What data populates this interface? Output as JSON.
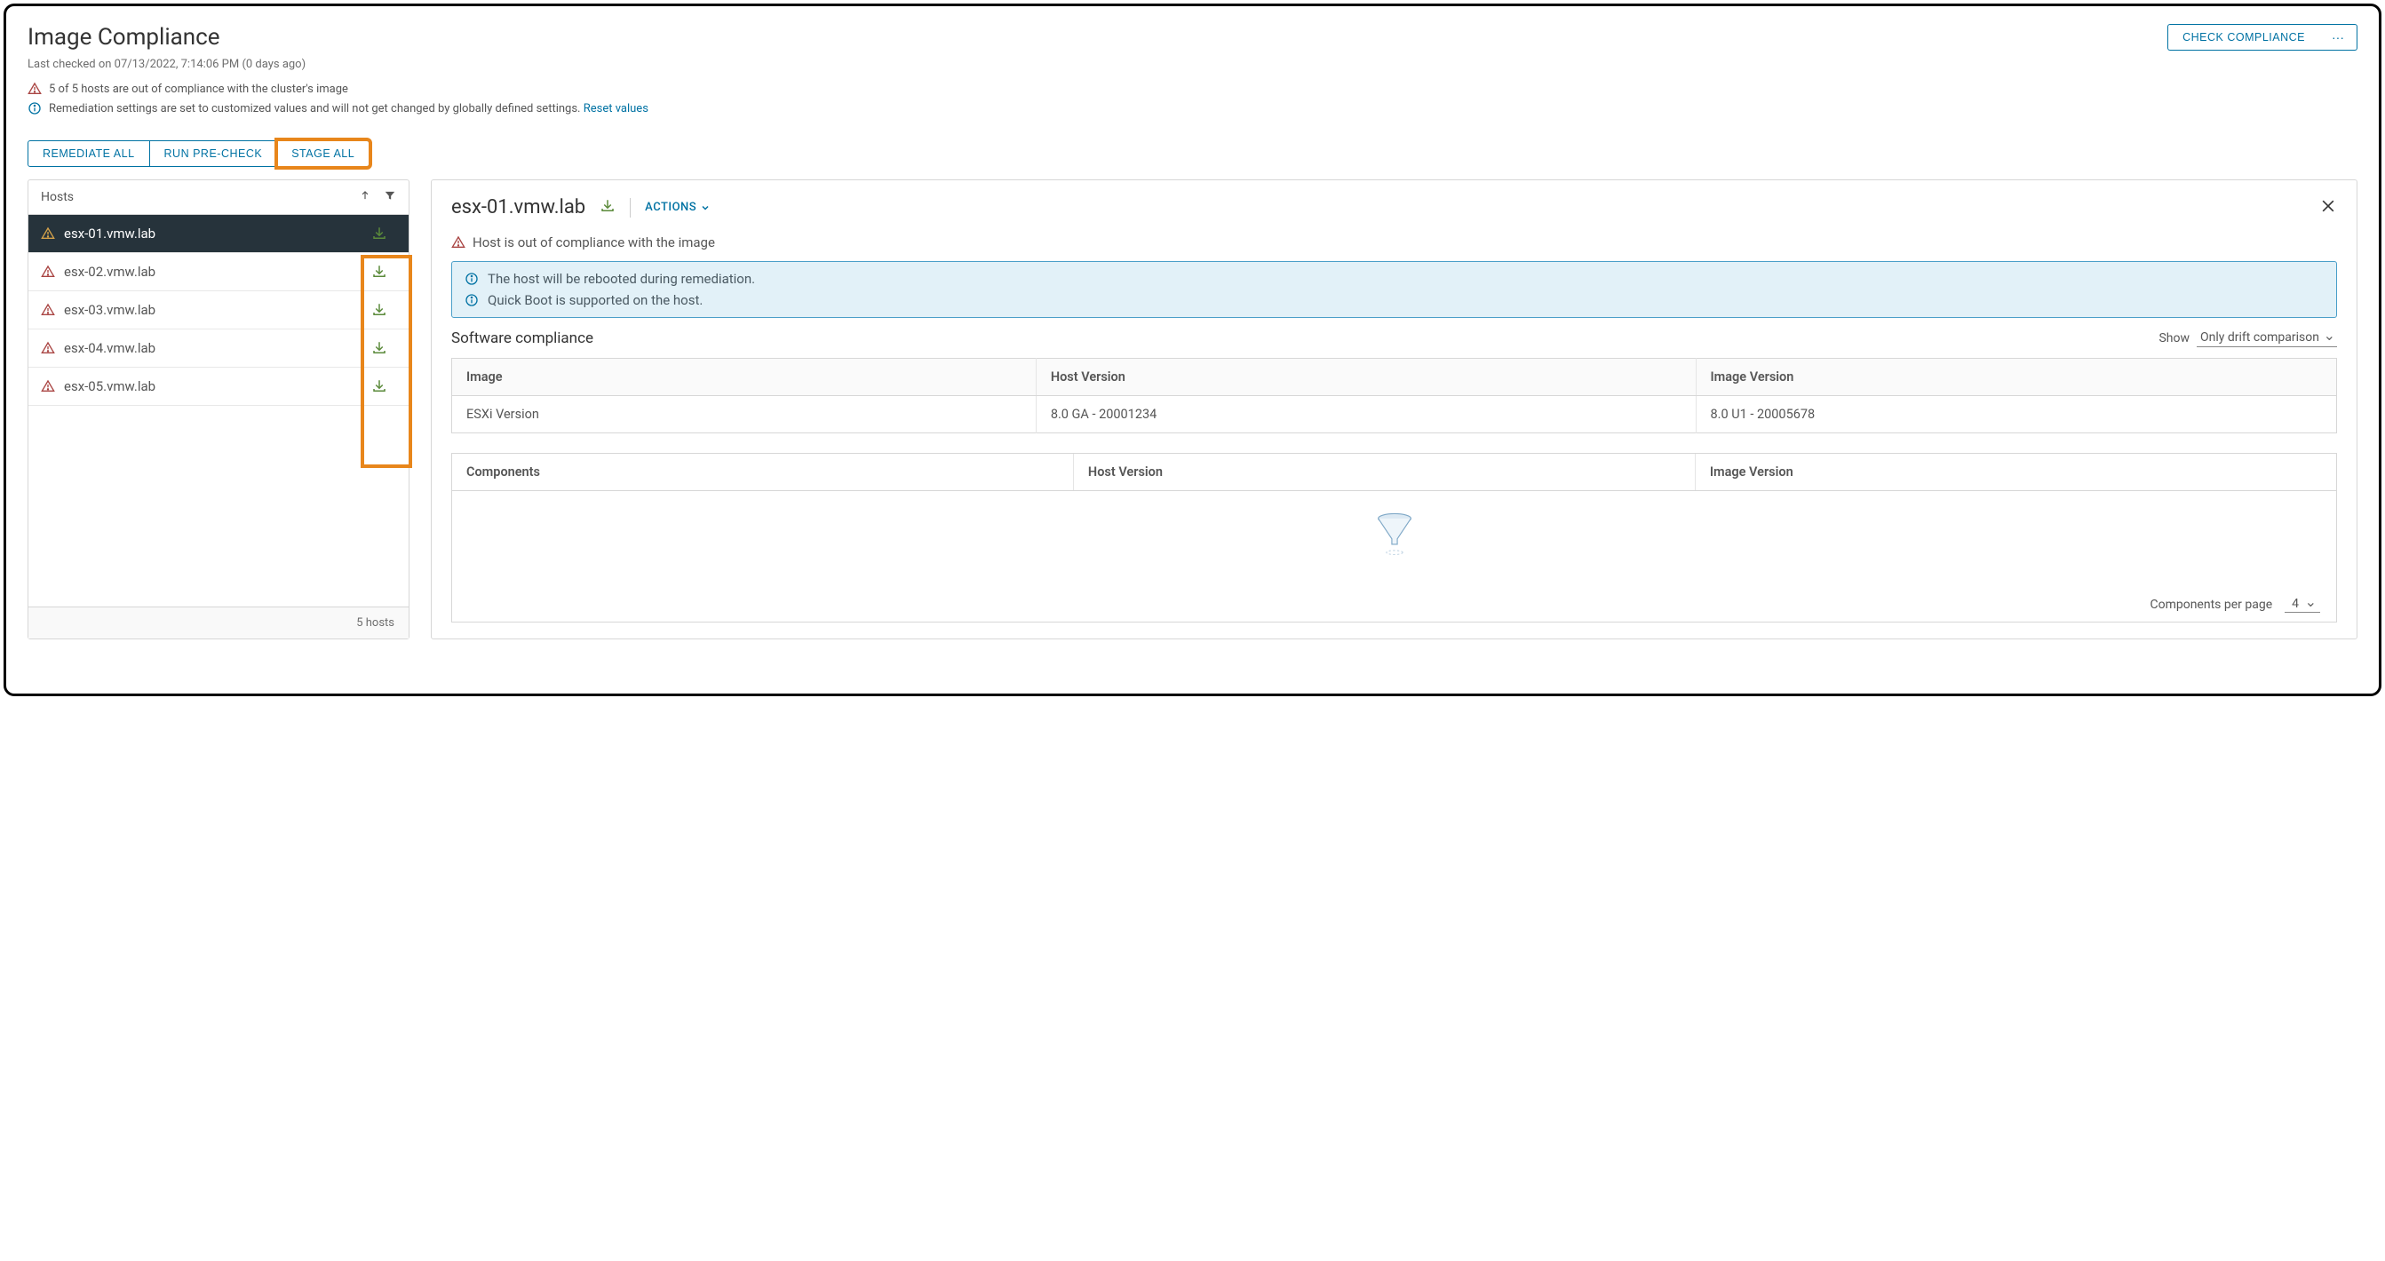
{
  "header": {
    "title": "Image Compliance",
    "last_checked": "Last checked on 07/13/2022, 7:14:06 PM (0 days ago)",
    "warning_text": "5 of 5 hosts are out of compliance with the cluster's image",
    "info_text": "Remediation settings are set to customized values and will not get changed by globally defined settings. ",
    "reset_link": "Reset values",
    "check_compliance": "CHECK COMPLIANCE",
    "more": "···"
  },
  "actions": {
    "remediate_all": "REMEDIATE ALL",
    "run_precheck": "RUN PRE-CHECK",
    "stage_all": "STAGE ALL"
  },
  "hosts_panel": {
    "header": "Hosts",
    "items": [
      {
        "name": "esx-01.vmw.lab",
        "selected": true
      },
      {
        "name": "esx-02.vmw.lab",
        "selected": false
      },
      {
        "name": "esx-03.vmw.lab",
        "selected": false
      },
      {
        "name": "esx-04.vmw.lab",
        "selected": false
      },
      {
        "name": "esx-05.vmw.lab",
        "selected": false
      }
    ],
    "footer": "5 hosts"
  },
  "detail": {
    "title": "esx-01.vmw.lab",
    "actions_label": "ACTIONS",
    "noncompliant_text": "Host is out of compliance with the image",
    "callout": {
      "line1": "The host will be rebooted during remediation.",
      "line2": "Quick Boot is supported on the host."
    },
    "software": {
      "title": "Software compliance",
      "show_label": "Show",
      "show_value": "Only drift comparison",
      "table": {
        "headers": [
          "Image",
          "Host Version",
          "Image Version"
        ],
        "rows": [
          [
            "ESXi Version",
            "8.0 GA - 20001234",
            "8.0 U1 - 20005678"
          ]
        ]
      },
      "components": {
        "headers": [
          "Components",
          "Host Version",
          "Image Version"
        ],
        "per_page_label": "Components per page",
        "per_page_value": "4"
      }
    }
  }
}
